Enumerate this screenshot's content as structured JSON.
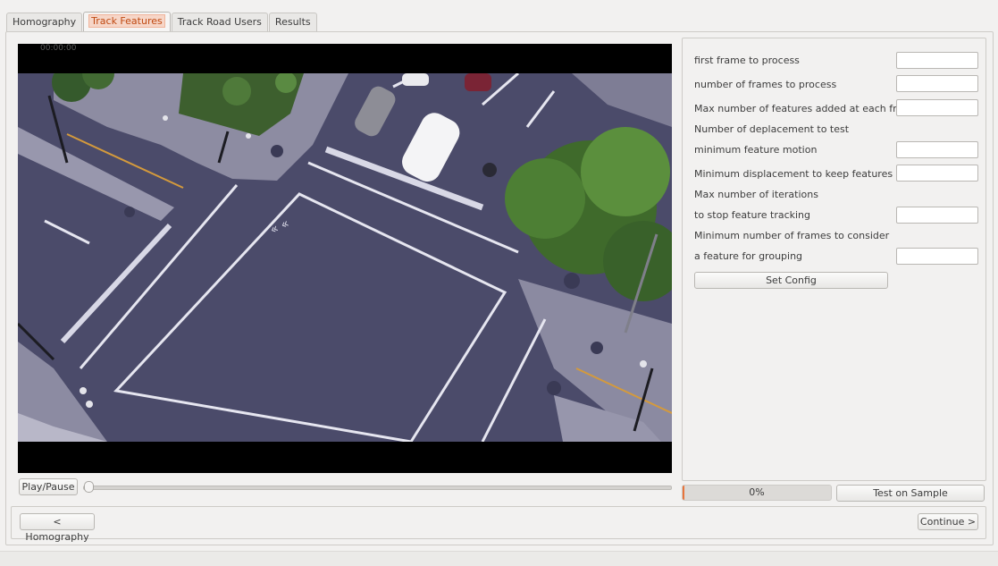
{
  "tabs": [
    {
      "label": "Homography",
      "active": false
    },
    {
      "label": "Track Features",
      "active": true
    },
    {
      "label": "Track Road Users",
      "active": false
    },
    {
      "label": "Results",
      "active": false
    }
  ],
  "video": {
    "timestamp": "00:00:00"
  },
  "config": {
    "rows": [
      {
        "label": "first frame to process",
        "has_input": true,
        "value": ""
      },
      {
        "label": "number of frames to process",
        "has_input": true,
        "value": ""
      },
      {
        "label": "Max number of features added at each frame",
        "has_input": true,
        "value": ""
      },
      {
        "label": "Number of deplacement to test",
        "has_input": false
      },
      {
        "label": "minimum feature motion",
        "has_input": true,
        "value": ""
      },
      {
        "label": "Minimum displacement to keep features (px)",
        "has_input": true,
        "value": ""
      },
      {
        "label": "Max number of iterations",
        "has_input": false
      },
      {
        "label": "to stop feature tracking",
        "has_input": true,
        "value": ""
      },
      {
        "label": "Minimum number of frames to consider",
        "has_input": false
      },
      {
        "label": "a feature for grouping",
        "has_input": true,
        "value": ""
      }
    ],
    "set_config_label": "Set Config"
  },
  "player": {
    "play_pause_label": "Play/Pause",
    "slider_position": 0
  },
  "progress": {
    "value_text": "0%",
    "fraction": 0.0,
    "fill_color": "#e8743b"
  },
  "test_on_sample_label": "Test on Sample",
  "navigation": {
    "back_label": "< Homography",
    "continue_label": "Continue >"
  },
  "colors": {
    "active_tab_text": "#c04a12",
    "active_tab_highlight": "#f6d6c8"
  }
}
